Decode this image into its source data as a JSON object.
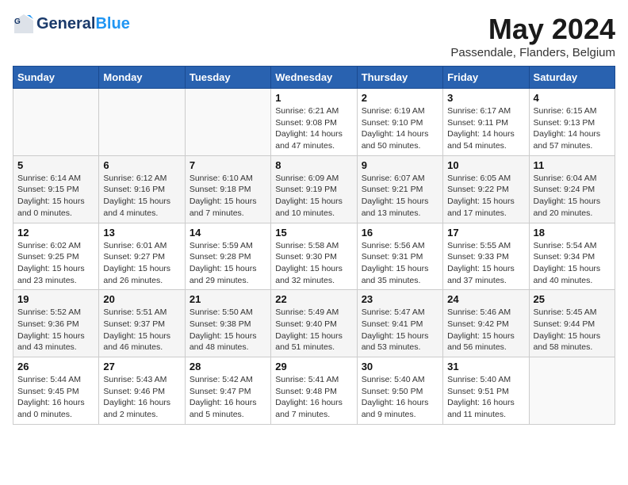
{
  "logo": {
    "text_general": "General",
    "text_blue": "Blue"
  },
  "title": {
    "month_year": "May 2024",
    "location": "Passendale, Flanders, Belgium"
  },
  "weekdays": [
    "Sunday",
    "Monday",
    "Tuesday",
    "Wednesday",
    "Thursday",
    "Friday",
    "Saturday"
  ],
  "weeks": [
    [
      {
        "day": "",
        "info": ""
      },
      {
        "day": "",
        "info": ""
      },
      {
        "day": "",
        "info": ""
      },
      {
        "day": "1",
        "info": "Sunrise: 6:21 AM\nSunset: 9:08 PM\nDaylight: 14 hours and 47 minutes."
      },
      {
        "day": "2",
        "info": "Sunrise: 6:19 AM\nSunset: 9:10 PM\nDaylight: 14 hours and 50 minutes."
      },
      {
        "day": "3",
        "info": "Sunrise: 6:17 AM\nSunset: 9:11 PM\nDaylight: 14 hours and 54 minutes."
      },
      {
        "day": "4",
        "info": "Sunrise: 6:15 AM\nSunset: 9:13 PM\nDaylight: 14 hours and 57 minutes."
      }
    ],
    [
      {
        "day": "5",
        "info": "Sunrise: 6:14 AM\nSunset: 9:15 PM\nDaylight: 15 hours and 0 minutes."
      },
      {
        "day": "6",
        "info": "Sunrise: 6:12 AM\nSunset: 9:16 PM\nDaylight: 15 hours and 4 minutes."
      },
      {
        "day": "7",
        "info": "Sunrise: 6:10 AM\nSunset: 9:18 PM\nDaylight: 15 hours and 7 minutes."
      },
      {
        "day": "8",
        "info": "Sunrise: 6:09 AM\nSunset: 9:19 PM\nDaylight: 15 hours and 10 minutes."
      },
      {
        "day": "9",
        "info": "Sunrise: 6:07 AM\nSunset: 9:21 PM\nDaylight: 15 hours and 13 minutes."
      },
      {
        "day": "10",
        "info": "Sunrise: 6:05 AM\nSunset: 9:22 PM\nDaylight: 15 hours and 17 minutes."
      },
      {
        "day": "11",
        "info": "Sunrise: 6:04 AM\nSunset: 9:24 PM\nDaylight: 15 hours and 20 minutes."
      }
    ],
    [
      {
        "day": "12",
        "info": "Sunrise: 6:02 AM\nSunset: 9:25 PM\nDaylight: 15 hours and 23 minutes."
      },
      {
        "day": "13",
        "info": "Sunrise: 6:01 AM\nSunset: 9:27 PM\nDaylight: 15 hours and 26 minutes."
      },
      {
        "day": "14",
        "info": "Sunrise: 5:59 AM\nSunset: 9:28 PM\nDaylight: 15 hours and 29 minutes."
      },
      {
        "day": "15",
        "info": "Sunrise: 5:58 AM\nSunset: 9:30 PM\nDaylight: 15 hours and 32 minutes."
      },
      {
        "day": "16",
        "info": "Sunrise: 5:56 AM\nSunset: 9:31 PM\nDaylight: 15 hours and 35 minutes."
      },
      {
        "day": "17",
        "info": "Sunrise: 5:55 AM\nSunset: 9:33 PM\nDaylight: 15 hours and 37 minutes."
      },
      {
        "day": "18",
        "info": "Sunrise: 5:54 AM\nSunset: 9:34 PM\nDaylight: 15 hours and 40 minutes."
      }
    ],
    [
      {
        "day": "19",
        "info": "Sunrise: 5:52 AM\nSunset: 9:36 PM\nDaylight: 15 hours and 43 minutes."
      },
      {
        "day": "20",
        "info": "Sunrise: 5:51 AM\nSunset: 9:37 PM\nDaylight: 15 hours and 46 minutes."
      },
      {
        "day": "21",
        "info": "Sunrise: 5:50 AM\nSunset: 9:38 PM\nDaylight: 15 hours and 48 minutes."
      },
      {
        "day": "22",
        "info": "Sunrise: 5:49 AM\nSunset: 9:40 PM\nDaylight: 15 hours and 51 minutes."
      },
      {
        "day": "23",
        "info": "Sunrise: 5:47 AM\nSunset: 9:41 PM\nDaylight: 15 hours and 53 minutes."
      },
      {
        "day": "24",
        "info": "Sunrise: 5:46 AM\nSunset: 9:42 PM\nDaylight: 15 hours and 56 minutes."
      },
      {
        "day": "25",
        "info": "Sunrise: 5:45 AM\nSunset: 9:44 PM\nDaylight: 15 hours and 58 minutes."
      }
    ],
    [
      {
        "day": "26",
        "info": "Sunrise: 5:44 AM\nSunset: 9:45 PM\nDaylight: 16 hours and 0 minutes."
      },
      {
        "day": "27",
        "info": "Sunrise: 5:43 AM\nSunset: 9:46 PM\nDaylight: 16 hours and 2 minutes."
      },
      {
        "day": "28",
        "info": "Sunrise: 5:42 AM\nSunset: 9:47 PM\nDaylight: 16 hours and 5 minutes."
      },
      {
        "day": "29",
        "info": "Sunrise: 5:41 AM\nSunset: 9:48 PM\nDaylight: 16 hours and 7 minutes."
      },
      {
        "day": "30",
        "info": "Sunrise: 5:40 AM\nSunset: 9:50 PM\nDaylight: 16 hours and 9 minutes."
      },
      {
        "day": "31",
        "info": "Sunrise: 5:40 AM\nSunset: 9:51 PM\nDaylight: 16 hours and 11 minutes."
      },
      {
        "day": "",
        "info": ""
      }
    ]
  ]
}
